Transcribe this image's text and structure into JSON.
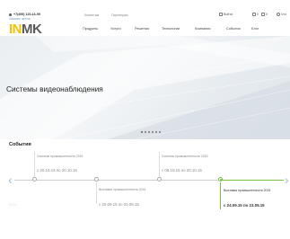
{
  "header": {
    "phone": "+7(495) 120-16-99",
    "callback": "Заказать звонок",
    "logo": {
      "part1": "IN",
      "part2": "MK",
      "color1": "#f2c100",
      "color2": "#58595b"
    },
    "top_links": [
      "Клиентам",
      "Партнерам"
    ],
    "utility": {
      "login": "Войти",
      "compare_count": "0",
      "favorites_count": "0",
      "search": "Что"
    },
    "nav": [
      "Продукты",
      "Услуги",
      "Решения",
      "Технологии",
      "Компания",
      "События",
      "Блог"
    ]
  },
  "hero": {
    "title": "Системы видеонаблюдения",
    "slides_total": 6,
    "active_slide": 0
  },
  "events": {
    "heading": "События",
    "items": [
      {
        "title": "Системы промышленности 2015",
        "date": "с 20.10.15 по 20.10.15",
        "active": false
      },
      {
        "title": "Выставка промышленности 2016",
        "date": "с 20.09.15 по 20.09.15",
        "active": false
      },
      {
        "title": "Системы промышленности 2015",
        "date": "с 06.10.15 по 20.10.15",
        "active": false
      },
      {
        "title": "Выставка промышленности 2015",
        "date": "с 24.09.15 по 23.09.15",
        "active": true
      }
    ],
    "faint_label": "10 10"
  },
  "colors": {
    "accent_green": "#7ac143",
    "arrow_blue": "#8fc0e8"
  }
}
